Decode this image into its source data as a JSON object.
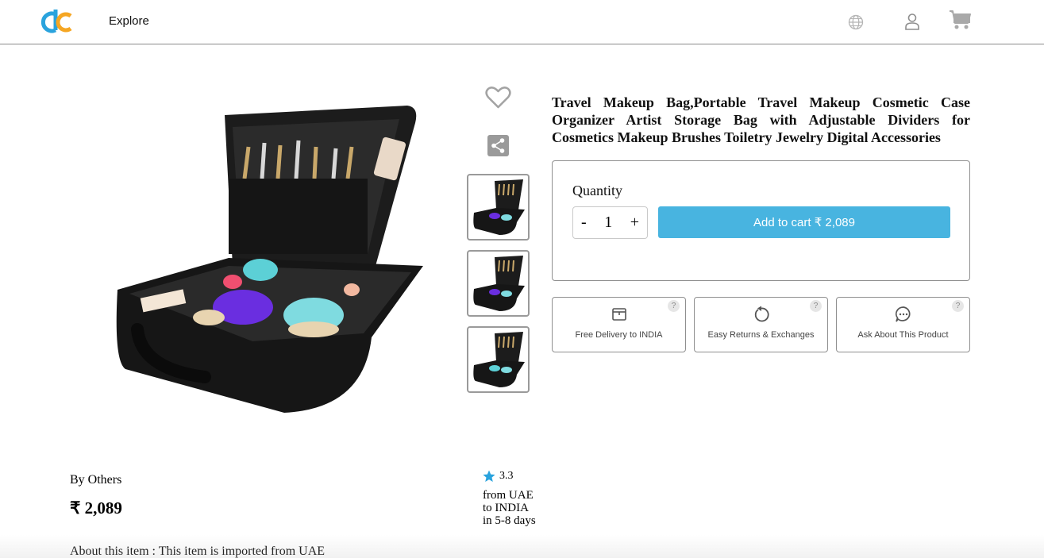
{
  "header": {
    "nav_explore": "Explore",
    "logo_icon": "dc-logo",
    "icons": [
      "globe-icon",
      "user-icon",
      "cart-icon"
    ]
  },
  "product": {
    "title": "Travel Makeup Bag,Portable Travel Makeup Cosmetic Case Organizer Artist Storage Bag with Adjustable Dividers for Cosmetics Makeup Brushes Toiletry Jewelry Digital Accessories",
    "seller": "By Others",
    "price": "₹ 2,089",
    "rating": "3.3",
    "shipping": [
      "from UAE",
      "to INDIA",
      "in 5-8 days"
    ],
    "about": "About this item : This item is imported from UAE",
    "thumbnail_count": 3
  },
  "purchase": {
    "quantity_label": "Quantity",
    "quantity_value": "1",
    "minus": "-",
    "plus": "+",
    "add_to_cart": "Add to cart ₹ 2,089"
  },
  "info_cards": [
    {
      "label": "Free Delivery to INDIA",
      "icon": "box-icon"
    },
    {
      "label": "Easy Returns & Exchanges",
      "icon": "return-icon"
    },
    {
      "label": "Ask About This Product",
      "icon": "chat-icon"
    }
  ],
  "colors": {
    "accent": "#48b4e0",
    "star": "#2aa3dd",
    "logo_blue": "#2aa3dd",
    "logo_orange": "#f5a623"
  }
}
